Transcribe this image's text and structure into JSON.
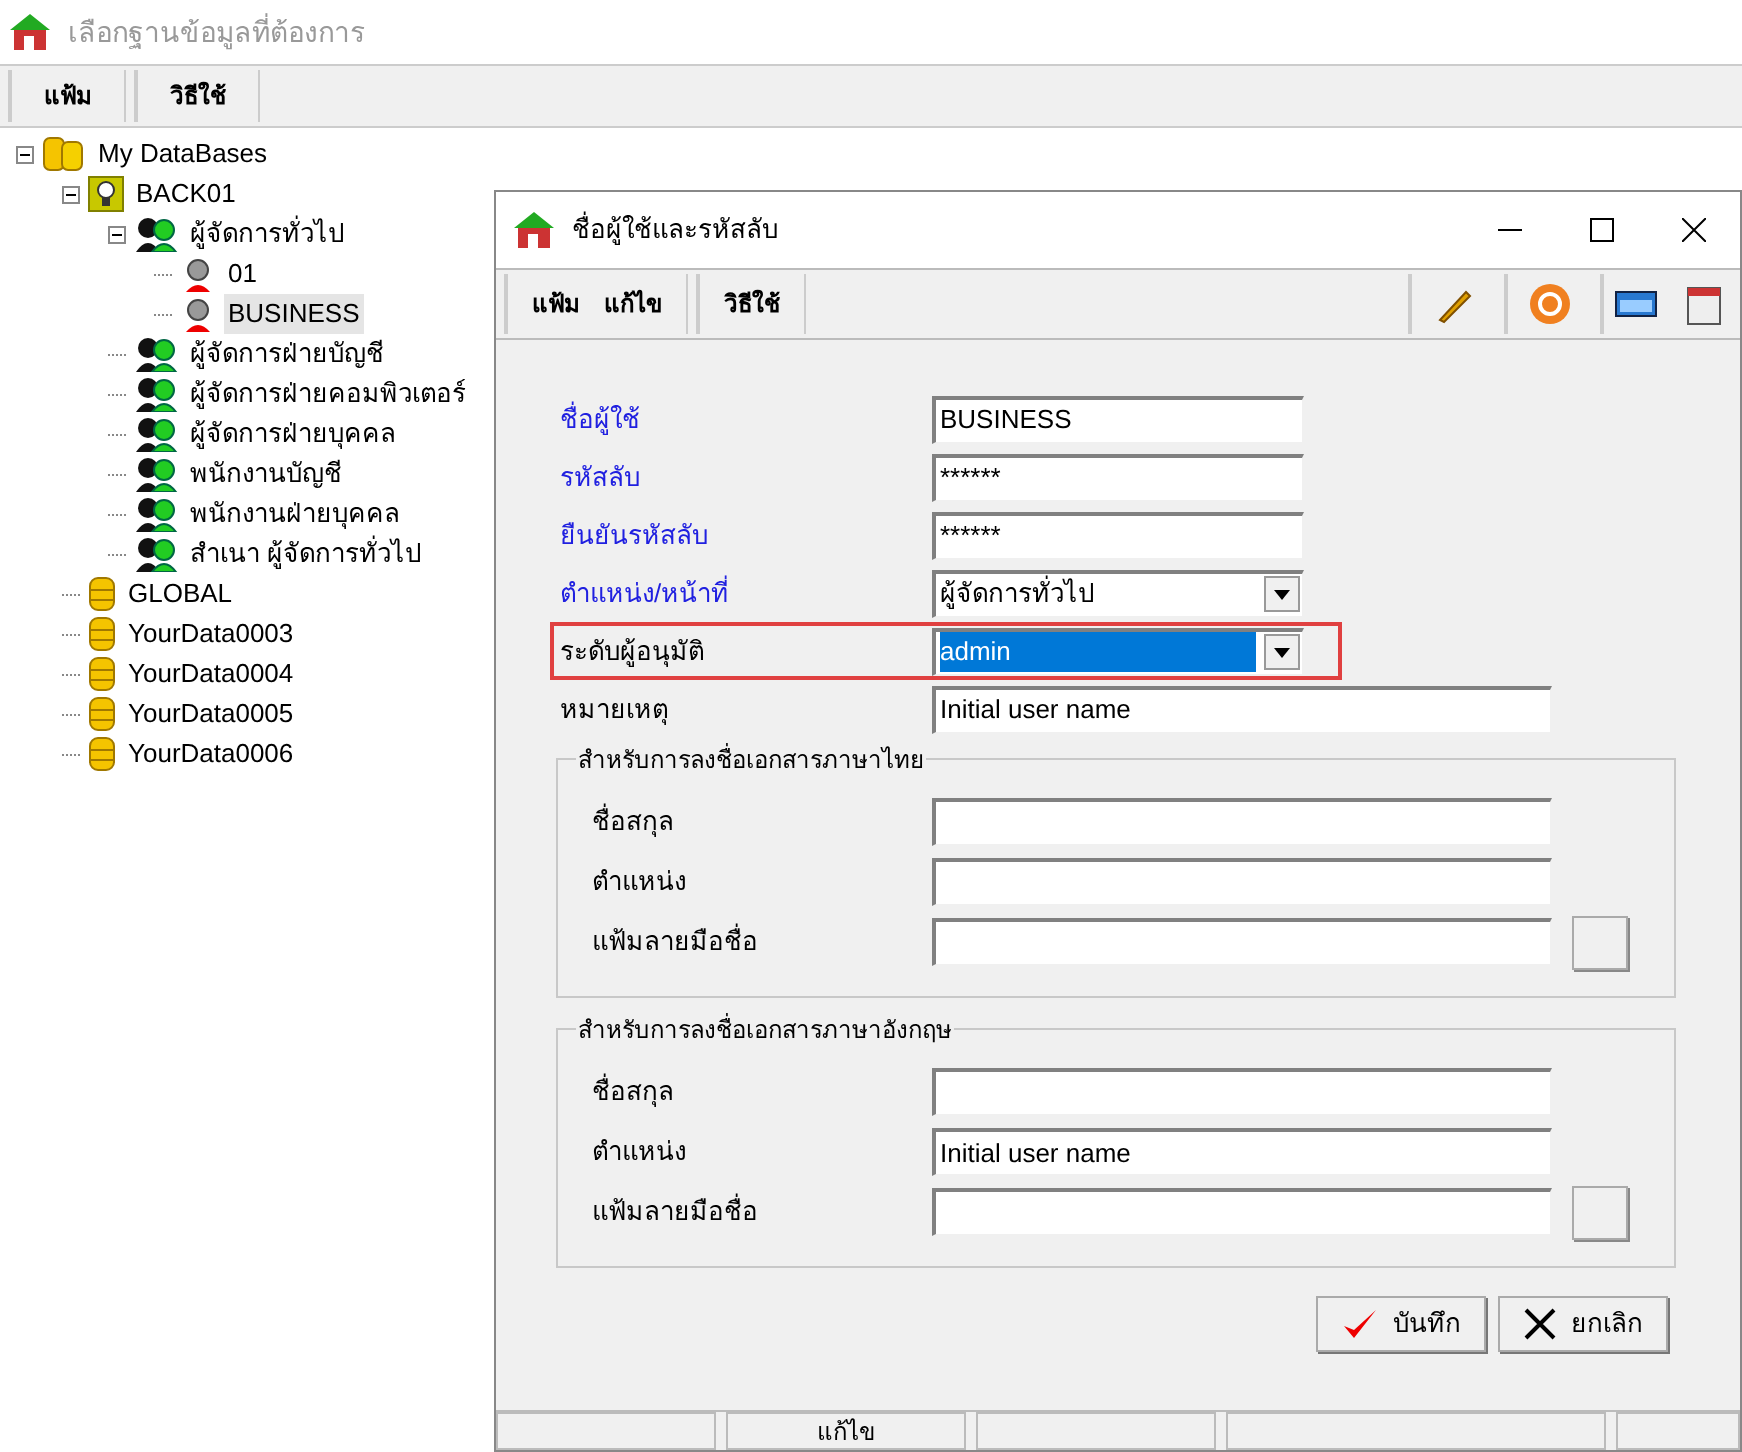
{
  "main_window": {
    "title": "เลือกฐานข้อมูลที่ต้องการ",
    "menu": [
      "แฟ้ม",
      "วิธีใช้"
    ]
  },
  "tree": [
    {
      "label": "My DataBases",
      "kind": "databases",
      "selected": false,
      "expanded": true,
      "children": [
        {
          "label": "BACK01",
          "kind": "server",
          "selected": false,
          "expanded": true,
          "children": [
            {
              "label": "ผู้จัดการทั่วไป",
              "kind": "group",
              "selected": false,
              "expanded": true,
              "children": [
                {
                  "label": "01",
                  "kind": "user",
                  "selected": false
                },
                {
                  "label": "BUSINESS",
                  "kind": "user",
                  "selected": true
                }
              ]
            },
            {
              "label": "ผู้จัดการฝ่ายบัญชี",
              "kind": "group",
              "selected": false
            },
            {
              "label": "ผู้จัดการฝ่ายคอมพิวเตอร์",
              "kind": "group",
              "selected": false
            },
            {
              "label": "ผู้จัดการฝ่ายบุคคล",
              "kind": "group",
              "selected": false
            },
            {
              "label": "พนักงานบัญชี",
              "kind": "group",
              "selected": false
            },
            {
              "label": "พนักงานฝ่ายบุคคล",
              "kind": "group",
              "selected": false
            },
            {
              "label": "สำเนา ผู้จัดการทั่วไป",
              "kind": "group",
              "selected": false
            }
          ]
        },
        {
          "label": "GLOBAL",
          "kind": "database",
          "selected": false
        },
        {
          "label": "YourData0003",
          "kind": "database",
          "selected": false
        },
        {
          "label": "YourData0004",
          "kind": "database",
          "selected": false
        },
        {
          "label": "YourData0005",
          "kind": "database",
          "selected": false
        },
        {
          "label": "YourData0006",
          "kind": "database",
          "selected": false
        }
      ]
    }
  ],
  "dialog": {
    "title": "ชื่อผู้ใช้และรหัสลับ",
    "menu_groups": [
      [
        "แฟ้ม",
        "แก้ไข"
      ],
      [
        "วิธีใช้"
      ]
    ],
    "fields": [
      {
        "label": "ชื่อผู้ใช้",
        "value": "BUSINESS",
        "kind": "text",
        "required": true,
        "highlighted": false
      },
      {
        "label": "รหัสลับ",
        "value": "******",
        "kind": "text",
        "required": true,
        "highlighted": false
      },
      {
        "label": "ยืนยันรหัสลับ",
        "value": "******",
        "kind": "text",
        "required": true,
        "highlighted": false
      },
      {
        "label": "ตำแหน่ง/หน้าที่",
        "value": "ผู้จัดการทั่วไป",
        "kind": "combo",
        "required": true,
        "highlighted": false
      },
      {
        "label": "ระดับผู้อนุมัติ",
        "value": "admin",
        "kind": "combo",
        "required": false,
        "highlighted": true
      },
      {
        "label": "หมายเหตุ",
        "value": "Initial user name",
        "kind": "wide",
        "required": false,
        "highlighted": false
      }
    ],
    "groups": [
      {
        "title": "สำหรับการลงชื่อเอกสารภาษาไทย",
        "fields": [
          {
            "label": "ชื่อสกุล",
            "kind": "text"
          },
          {
            "label": "ตำแหน่ง",
            "kind": "text"
          },
          {
            "label": "แฟ้มลายมือชื่อ",
            "kind": "file"
          }
        ]
      },
      {
        "title": "สำหรับการลงชื่อเอกสารภาษาอังกฤษ",
        "fields": [
          {
            "label": "ชื่อสกุล",
            "kind": "text"
          },
          {
            "label": "ตำแหน่ง",
            "value": "Initial user name",
            "kind": "text"
          },
          {
            "label": "แฟ้มลายมือชื่อ",
            "kind": "file"
          }
        ]
      }
    ],
    "buttons": [
      {
        "label": "บันทึก",
        "kind": "save"
      },
      {
        "label": "ยกเลิก",
        "kind": "cancel"
      }
    ],
    "status_bar": {
      "mode": "แก้ไข"
    }
  }
}
